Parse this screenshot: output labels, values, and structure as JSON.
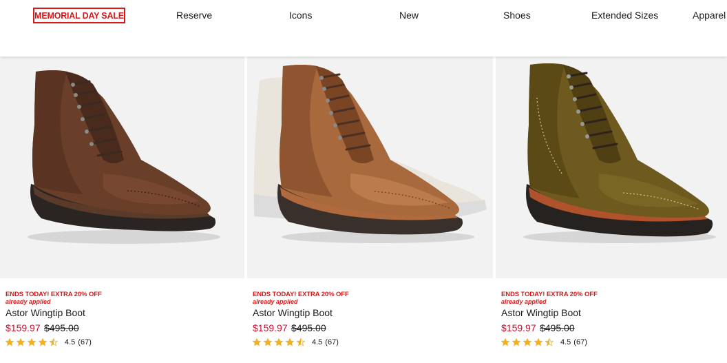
{
  "nav": {
    "sale_label": "MEMORIAL DAY SALE",
    "items": [
      {
        "label": "Reserve"
      },
      {
        "label": "Icons"
      },
      {
        "label": "New"
      },
      {
        "label": "Shoes"
      },
      {
        "label": "Extended Sizes"
      },
      {
        "label": "Apparel"
      }
    ]
  },
  "colors": {
    "sale_red": "#d31a1a",
    "price_red": "#c8102e",
    "star_gold": "#f2b01e",
    "image_bg": "#f2f2f2"
  },
  "products": [
    {
      "image_icon": "brown-pebble-grain-wingtip-boot-icon",
      "promo": "ENDS TODAY! EXTRA 20% OFF",
      "promo_note": "already applied",
      "name": "Astor Wingtip Boot",
      "sale_price": "$159.97",
      "original_price": "$495.00",
      "rating": 4.5,
      "rating_text": "4.5",
      "review_count": "(67)"
    },
    {
      "image_icon": "tan-leather-wingtip-boot-icon",
      "promo": "ENDS TODAY! EXTRA 20% OFF",
      "promo_note": "already applied",
      "name": "Astor Wingtip Boot",
      "sale_price": "$159.97",
      "original_price": "$495.00",
      "rating": 4.5,
      "rating_text": "4.5",
      "review_count": "(67)"
    },
    {
      "image_icon": "olive-suede-wingtip-boot-icon",
      "promo": "ENDS TODAY! EXTRA 20% OFF",
      "promo_note": "already applied",
      "name": "Astor Wingtip Boot",
      "sale_price": "$159.97",
      "original_price": "$495.00",
      "rating": 4.5,
      "rating_text": "4.5",
      "review_count": "(67)"
    }
  ]
}
